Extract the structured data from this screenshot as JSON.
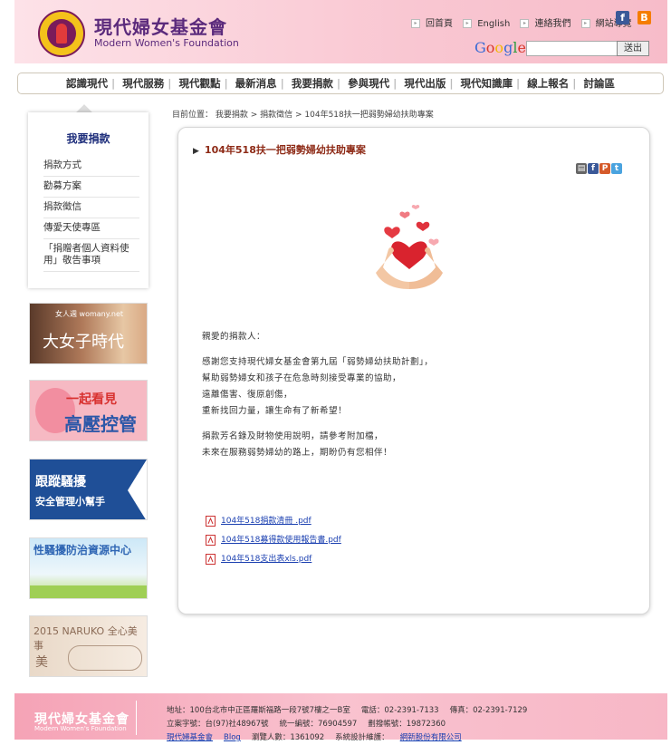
{
  "header": {
    "logo_cn": "現代婦女基金會",
    "logo_en": "Modern Women's Foundation",
    "top_links": [
      "回首頁",
      "English",
      "連絡我們",
      "網站導覽"
    ],
    "search_placeholder": "",
    "search_button": "送出",
    "google_label": "Google"
  },
  "nav": [
    "認識現代",
    "現代服務",
    "現代觀點",
    "最新消息",
    "我要捐款",
    "參與現代",
    "現代出版",
    "現代知識庫",
    "線上報名",
    "討論區"
  ],
  "sidebar": {
    "title": "我要捐款",
    "items": [
      "捐款方式",
      "勸募方案",
      "捐款徵信",
      "傳愛天使專區",
      "「捐贈者個人資料使用」敬告事項"
    ]
  },
  "banners": {
    "b1_small": "女人週 womany.net",
    "b1_main": "大女子時代",
    "b2_line1": "一起看見",
    "b2_line2": "高壓控管",
    "b3_line1": "跟蹤騷擾",
    "b3_line2": "安全管理小幫手",
    "b4_line1": "性騷擾防治資源中心",
    "b5_line1": "2015 NARUKO 全心美事",
    "b5_line2": "美"
  },
  "breadcrumb": "目前位置： 我要捐款 > 捐款徵信 > 104年518扶一把弱勢婦幼扶助專案",
  "content": {
    "title": "104年518扶一把弱勢婦幼扶助專案",
    "greeting": "親愛的捐款人：",
    "para1": [
      "感謝您支持現代婦女基金會第九屆「弱勢婦幼扶助計劃」，",
      "幫助弱勢婦女和孩子在危急時刻接受專業的協助，",
      "遠離傷害、復原創傷，",
      "重新找回力量，讓生命有了新希望！"
    ],
    "para2": [
      "捐款芳名錄及財物使用說明，請參考附加檔，",
      "未來在服務弱勢婦幼的路上，期盼仍有您相伴！"
    ],
    "files": [
      "104年518捐款清冊 .pdf",
      "104年518募得款使用報告書.pdf",
      "104年518支出表xls.pdf"
    ]
  },
  "footer": {
    "logo_cn": "現代婦女基金會",
    "logo_en": "Modern Women's Foundation",
    "address": "地址：100台北市中正區羅斯福路一段7號7樓之一B室",
    "phone": "電話：02-2391-7133",
    "fax": "傳真：02-2391-7129",
    "registration": "立案字號：台(97)社48967號",
    "tax_id": "統一編號：76904597",
    "postal": "劃撥帳號：19872360",
    "row3_link1": "現代婦基金會",
    "row3_link2": "Blog",
    "visitors": "瀏覽人數：1361092",
    "designer_label": "系統設計維護：",
    "designer_link": "網新股份有限公司"
  },
  "colors": {
    "header_pink": "#f9c7d2",
    "footer_pink": "#f5a3b6",
    "title_brown": "#8e2b17",
    "link_blue": "#1a3fb0",
    "side_title_navy": "#1c2c7a"
  }
}
